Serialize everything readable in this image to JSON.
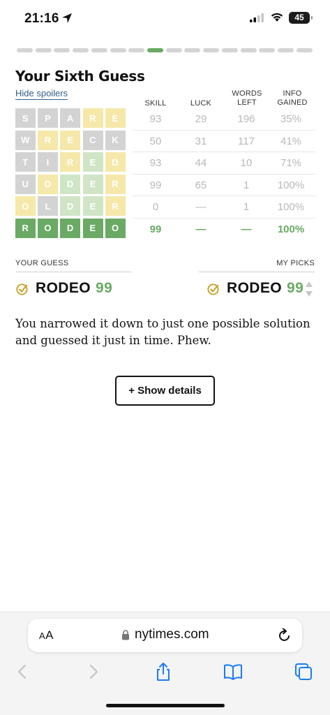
{
  "status": {
    "time": "21:16",
    "battery": "45"
  },
  "progress": {
    "total": 16,
    "active_index": 7
  },
  "section": {
    "title": "Your Sixth Guess",
    "spoilers_link": "Hide spoilers"
  },
  "columns": {
    "skill": "SKILL",
    "luck": "LUCK",
    "words_left": "WORDS\nLEFT",
    "info": "INFO\nGAINED"
  },
  "colors": {
    "green": "#6aaa64",
    "yellow": "#f5e8a8",
    "light_green": "#cfe5c6",
    "gray": "#d3d3d3"
  },
  "guesses": [
    {
      "letters": [
        "S",
        "P",
        "A",
        "R",
        "E"
      ],
      "colors": [
        "gray",
        "gray",
        "gray",
        "yellow",
        "yellow"
      ],
      "skill": "93",
      "luck": "29",
      "words_left": "196",
      "info": "35%"
    },
    {
      "letters": [
        "W",
        "R",
        "E",
        "C",
        "K"
      ],
      "colors": [
        "gray",
        "yellow",
        "yellow",
        "gray",
        "gray"
      ],
      "skill": "50",
      "luck": "31",
      "words_left": "117",
      "info": "41%"
    },
    {
      "letters": [
        "T",
        "I",
        "R",
        "E",
        "D"
      ],
      "colors": [
        "gray",
        "gray",
        "yellow",
        "green",
        "yellow"
      ],
      "skill": "93",
      "luck": "44",
      "words_left": "10",
      "info": "71%"
    },
    {
      "letters": [
        "U",
        "D",
        "D",
        "E",
        "R"
      ],
      "colors": [
        "gray",
        "yellow",
        "green",
        "green",
        "yellow"
      ],
      "skill": "99",
      "luck": "65",
      "words_left": "1",
      "info": "100%"
    },
    {
      "letters": [
        "O",
        "L",
        "D",
        "E",
        "R"
      ],
      "colors": [
        "yellow",
        "gray",
        "green",
        "green",
        "yellow"
      ],
      "skill": "0",
      "luck": "—",
      "words_left": "1",
      "info": "100%"
    },
    {
      "letters": [
        "R",
        "O",
        "D",
        "E",
        "O"
      ],
      "colors": [
        "full",
        "full",
        "full",
        "full",
        "full"
      ],
      "skill": "99",
      "luck": "—",
      "words_left": "—",
      "info": "100%"
    }
  ],
  "your_guess": {
    "label": "YOUR GUESS",
    "word": "RODEO",
    "score": "99"
  },
  "my_picks": {
    "label": "MY PICKS",
    "word": "RODEO",
    "score": "99"
  },
  "summary": "You narrowed it down to just one possible solution and guessed it just in time. Phew.",
  "details_button": "+ Show details",
  "browser": {
    "aa_label": "AA",
    "url": "nytimes.com"
  }
}
